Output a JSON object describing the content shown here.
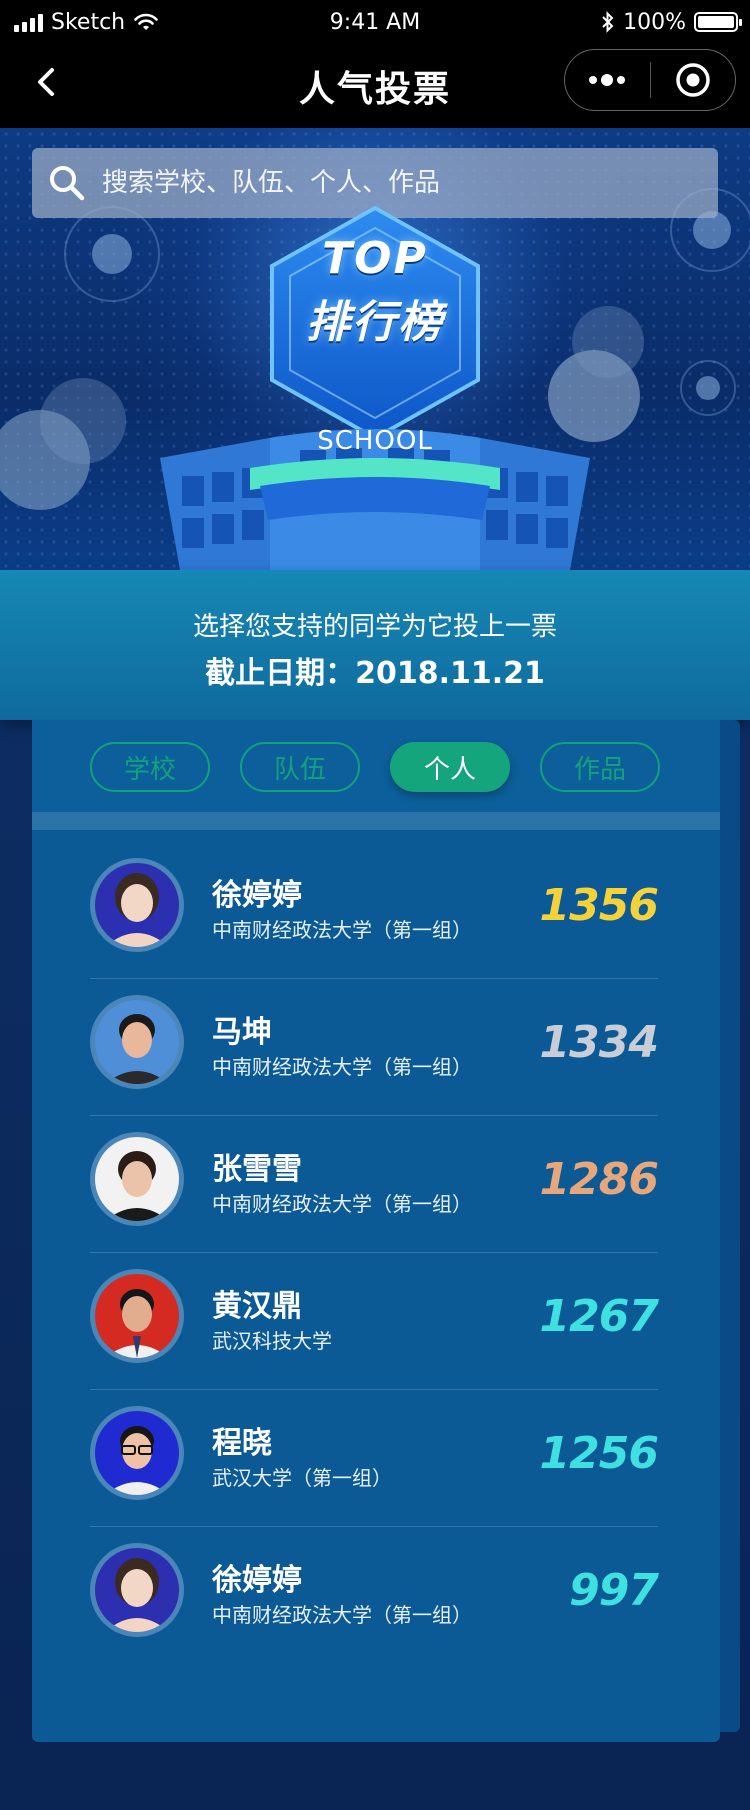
{
  "status_bar": {
    "carrier": "Sketch",
    "time": "9:41 AM",
    "battery": "100%"
  },
  "nav": {
    "title": "人气投票"
  },
  "banner": {
    "search_placeholder": "搜索学校、队伍、个人、作品",
    "badge_line1": "TOP",
    "badge_line2": "排行榜",
    "school_label": "SCHOOL"
  },
  "info": {
    "line1": "选择您支持的同学为它投上一票",
    "line2": "截止日期：2018.11.21"
  },
  "tabs": [
    {
      "label": "学校",
      "active": false
    },
    {
      "label": "队伍",
      "active": false
    },
    {
      "label": "个人",
      "active": true
    },
    {
      "label": "作品",
      "active": false
    }
  ],
  "ranking": [
    {
      "name": "徐婷婷",
      "school": "中南财经政法大学（第一组）",
      "votes": "1356",
      "color": "#f6d23a",
      "avatar_bg": "#2b2fb0"
    },
    {
      "name": "马坤",
      "school": "中南财经政法大学（第一组）",
      "votes": "1334",
      "color": "#c9ced6",
      "avatar_bg": "#4f8fd8"
    },
    {
      "name": "张雪雪",
      "school": "中南财经政法大学（第一组）",
      "votes": "1286",
      "color": "#e7a77a",
      "avatar_bg": "#f2f2f2"
    },
    {
      "name": "黄汉鼎",
      "school": "武汉科技大学",
      "votes": "1267",
      "color": "#3fe0e0",
      "avatar_bg": "#d42a22"
    },
    {
      "name": "程晓",
      "school": "武汉大学（第一组）",
      "votes": "1256",
      "color": "#3fe0e0",
      "avatar_bg": "#1f2ad0"
    },
    {
      "name": "徐婷婷",
      "school": "中南财经政法大学（第一组）",
      "votes": "997",
      "color": "#3fe0e0",
      "avatar_bg": "#2b2fb0"
    }
  ]
}
